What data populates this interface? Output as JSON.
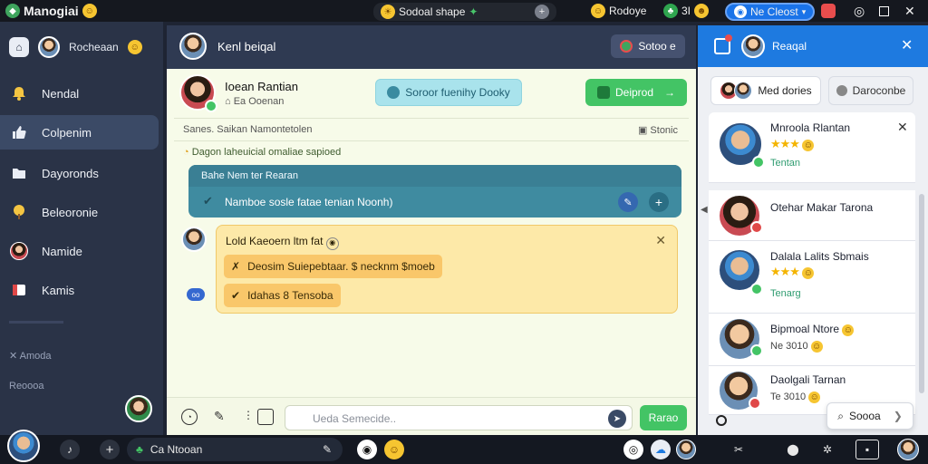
{
  "topbar": {
    "app_title": "Manogiai",
    "center_label": "Sodoal shape",
    "status_label": "Rodoye",
    "counter": "3I",
    "user_chip": "Ne Cleost"
  },
  "sidebar": {
    "profile_name": "Rocheaan",
    "items": [
      {
        "label": "Nendal"
      },
      {
        "label": "Colpenim"
      },
      {
        "label": "Dayoronds"
      },
      {
        "label": "Beleoronie"
      },
      {
        "label": "Namide"
      },
      {
        "label": "Kamis"
      }
    ],
    "section_a": "Amoda",
    "section_b": "Reoooa"
  },
  "main": {
    "header_title": "Kenl beiqal",
    "header_button": "Sotoo e",
    "chat_name": "Ioean Rantian",
    "chat_sub": "Ea Ooenan",
    "filter_button": "Soroor fuenihy Dooky",
    "primary_button": "Deiprod",
    "meta_left": "Sanes. Saikan Namontetolen",
    "meta_right": "Stonic",
    "info_line": "Dagon laheuicial omaliae sapioed",
    "blue_card": {
      "title": "Bahe Nem ter Rearan",
      "item": "Namboe sosle fatae tenian Noonh)"
    },
    "yellow_card": {
      "title": "Lold Kaeoern ltm fat",
      "chip1": "Deosim Suiepebtaar. $ necknm $moeb",
      "chip2": "Idahas 8 Tensoba"
    },
    "composer_placeholder": "Ueda Semecide..",
    "send_label": "Rarao"
  },
  "right": {
    "header_title": "Reaqal",
    "tab1": "Med dories",
    "tab2": "Daroconbe",
    "contacts": [
      {
        "name": "Mnroola Rlantan",
        "sub": "Tentan",
        "stars": "★★★"
      },
      {
        "name": "Otehar Makar Tarona",
        "sub": "",
        "stars": ""
      },
      {
        "name": "Dalala Lalits Sbmais",
        "sub": "Tenarg",
        "stars": "★★★"
      },
      {
        "name": "Bipmoal Ntore",
        "sub": "",
        "stars": ""
      },
      {
        "name": "Daolgali Tarnan",
        "sub": "Te 3010",
        "stars": ""
      }
    ],
    "sub4": "Ne 3010",
    "popup_label": "Soooa"
  },
  "taskbar": {
    "app_label": "Ca Ntooan"
  },
  "colors": {
    "accent_green": "#43c465",
    "accent_blue": "#1e7ae0",
    "sidebar": "#2a3347"
  }
}
